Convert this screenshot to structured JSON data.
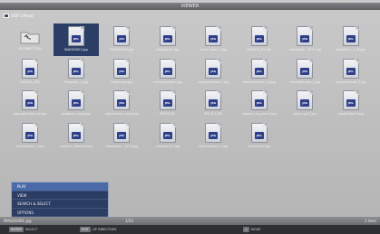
{
  "window": {
    "title": "VIEWER"
  },
  "path": {
    "label": "USB 1:Photo"
  },
  "grid": {
    "items": [
      {
        "type": "folder",
        "label": "UP DIRECTORY"
      },
      {
        "type": "file",
        "label": "IMAGE0001.jpg",
        "selected": true,
        "badge": "JPG"
      },
      {
        "type": "file",
        "label": "IMAGE0002.jpg",
        "badge": "JPG"
      },
      {
        "type": "file",
        "label": "diagram1a.jpg",
        "badge": "JPG"
      },
      {
        "type": "file",
        "label": "cover (cam) 1.jpg",
        "badge": "JPG"
      },
      {
        "type": "file",
        "label": "DANS76_PG.jpg",
        "badge": "JPG"
      },
      {
        "type": "file",
        "label": "eventmax - 2017.jpg",
        "badge": "JPG"
      },
      {
        "type": "file",
        "label": "Satellite_c_1.2t.jpg",
        "badge": "JPG"
      },
      {
        "type": "file",
        "label": "IMAGE2_SPG",
        "badge": "JPG"
      },
      {
        "type": "file",
        "label": "Snapshot_1.jpg",
        "badge": "JPG"
      },
      {
        "type": "file",
        "label": "Classroom.jpg",
        "badge": "JPG"
      },
      {
        "type": "file",
        "label": "summergarden.jpg",
        "badge": "JPG"
      },
      {
        "type": "file",
        "label": "mountainview 1.jpg",
        "badge": "JPG"
      },
      {
        "type": "file",
        "label": "mountainview_2a.jpg",
        "badge": "JPG"
      },
      {
        "type": "file",
        "label": "mountainview_3.jpg",
        "badge": "JPG"
      },
      {
        "type": "file",
        "label": "mountainview_5.jpg",
        "badge": "JPG"
      },
      {
        "type": "file",
        "label": "mountainview_5a.jpg",
        "badge": "JPG"
      },
      {
        "type": "file",
        "label": "outdoors (sea).jpg",
        "badge": "JPG"
      },
      {
        "type": "file",
        "label": "adjustment (cam).jpg",
        "badge": "JPG"
      },
      {
        "type": "file",
        "label": "P0016.JPG",
        "badge": "JPG"
      },
      {
        "type": "file",
        "label": "P0016 2.JPG",
        "badge": "JPG"
      },
      {
        "type": "file",
        "label": "camera_ex_pose 2.jpg",
        "badge": "JPG"
      },
      {
        "type": "file",
        "label": "room-ng17.jpg",
        "badge": "JPG"
      },
      {
        "type": "file",
        "label": "carrollside11.jpg",
        "badge": "JPG"
      },
      {
        "type": "file",
        "label": "casualwater_2.jpg",
        "badge": "JPG"
      },
      {
        "type": "file",
        "label": "capture_lessons7.jpg",
        "badge": "JPG"
      },
      {
        "type": "file",
        "label": "Classroom - 1110.jpg",
        "badge": "JPG"
      },
      {
        "type": "file",
        "label": "cutproduct7.jpg",
        "badge": "JPG"
      },
      {
        "type": "file",
        "label": "seminarroom 2.jpg",
        "badge": "JPG"
      },
      {
        "type": "file",
        "label": "mountain4.jpg",
        "badge": "JPG"
      }
    ]
  },
  "menu": {
    "items": [
      "PLAY",
      "VIEW",
      "SEARCH & SELECT",
      "OPTIONS"
    ],
    "active_index": 0
  },
  "status": {
    "filename": "IMAGE0001.jpg",
    "position": "1/33",
    "count": "1 item"
  },
  "hints": [
    {
      "key": "ENTER",
      "label": "SELECT"
    },
    {
      "key": "EXIT",
      "label": "UP DIRECTORY"
    },
    {
      "key": "◇",
      "label": "MOVE"
    }
  ]
}
